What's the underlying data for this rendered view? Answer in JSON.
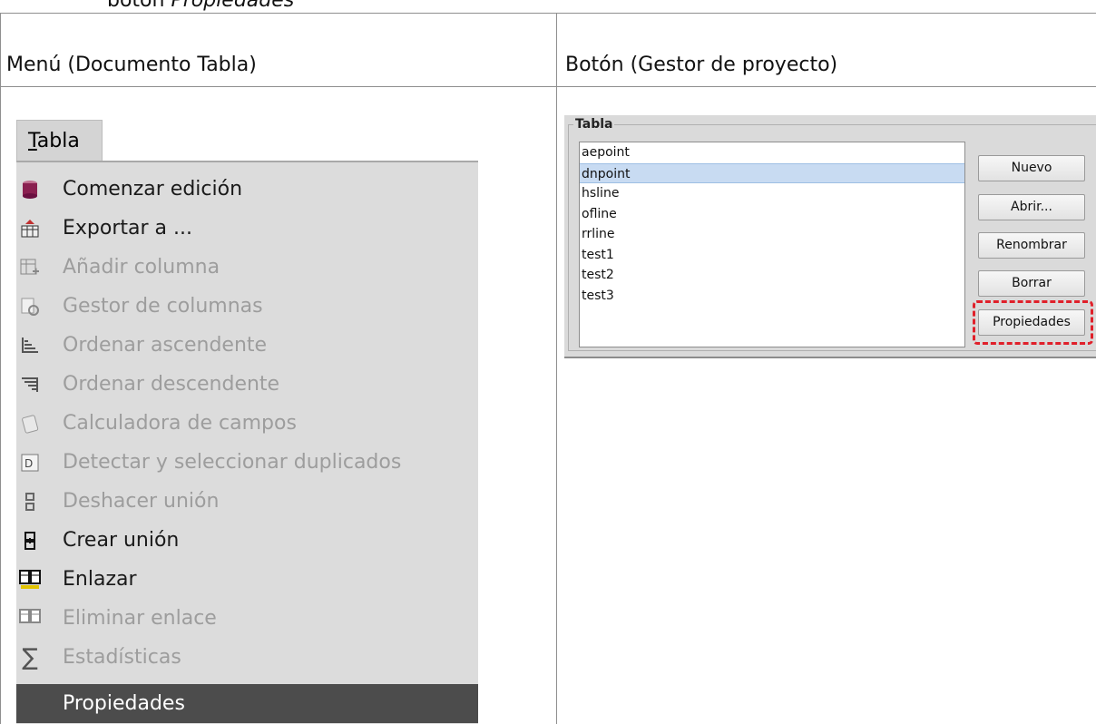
{
  "caption": {
    "prefix": "botón ",
    "italic": "Propiedades"
  },
  "table": {
    "headers": [
      "Menú (Documento Tabla)",
      "Botón (Gestor de proyecto)"
    ]
  },
  "menu": {
    "title": "Tabla",
    "items": [
      {
        "label": "Comenzar edición",
        "enabled": true,
        "icon": "database-cylinder-icon"
      },
      {
        "label": "Exportar a ...",
        "enabled": true,
        "icon": "export-table-icon"
      },
      {
        "label": "Añadir columna",
        "enabled": false,
        "icon": "add-column-icon"
      },
      {
        "label": "Gestor de columnas",
        "enabled": false,
        "icon": "column-manager-icon"
      },
      {
        "label": "Ordenar ascendente",
        "enabled": false,
        "icon": "sort-ascending-icon"
      },
      {
        "label": "Ordenar descendente",
        "enabled": false,
        "icon": "sort-descending-icon"
      },
      {
        "label": "Calculadora de campos",
        "enabled": false,
        "icon": "field-calculator-icon"
      },
      {
        "label": "Detectar y seleccionar duplicados",
        "enabled": false,
        "icon": "duplicates-icon"
      },
      {
        "label": "Deshacer unión",
        "enabled": false,
        "icon": "unjoin-icon"
      },
      {
        "label": "Crear unión",
        "enabled": true,
        "icon": "join-icon"
      },
      {
        "label": "Enlazar",
        "enabled": true,
        "icon": "link-icon"
      },
      {
        "label": "Eliminar enlace",
        "enabled": false,
        "icon": "remove-link-icon"
      },
      {
        "label": "Estadísticas",
        "enabled": false,
        "icon": "sigma-icon"
      },
      {
        "label": "Propiedades",
        "enabled": true,
        "selected": true,
        "icon": ""
      }
    ]
  },
  "project_manager": {
    "legend": "Tabla",
    "list": [
      "aepoint",
      "dnpoint",
      "hsline",
      "ofline",
      "rrline",
      "test1",
      "test2",
      "test3"
    ],
    "selected": "dnpoint",
    "buttons": {
      "new": "Nuevo",
      "open": "Abrir...",
      "rename": "Renombrar",
      "delete": "Borrar",
      "properties": "Propiedades"
    },
    "highlight_color": "#e0202a"
  }
}
